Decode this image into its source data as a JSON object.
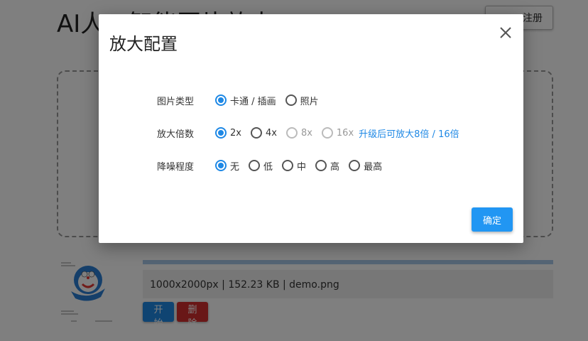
{
  "background": {
    "page_title": "AI人工智能图片放大",
    "auth_button_label": "注册",
    "file_info": "1000x2000px | 152.23 KB | demo.png",
    "start_button_label": "开始",
    "delete_button_label": "删除",
    "upload_progress": 1.0
  },
  "modal": {
    "title": "放大配置",
    "image_type": {
      "label": "图片类型",
      "options": [
        {
          "label": "卡通 / 插画",
          "checked": true
        },
        {
          "label": "照片",
          "checked": false
        }
      ]
    },
    "scale": {
      "label": "放大倍数",
      "options": [
        {
          "label": "2x",
          "checked": true
        },
        {
          "label": "4x",
          "checked": false
        },
        {
          "label": "8x",
          "checked": false,
          "disabled": true
        },
        {
          "label": "16x",
          "checked": false,
          "disabled": true
        }
      ],
      "upgrade_note": "升级后可放大8倍 / 16倍"
    },
    "denoise": {
      "label": "降噪程度",
      "options": [
        {
          "label": "无",
          "checked": true
        },
        {
          "label": "低",
          "checked": false
        },
        {
          "label": "中",
          "checked": false
        },
        {
          "label": "高",
          "checked": false
        },
        {
          "label": "最高",
          "checked": false
        }
      ]
    },
    "confirm_button_label": "确定"
  },
  "colors": {
    "accent": "#2196f3",
    "danger": "#d32f2f",
    "overlay": "rgba(0,0,0,0.5)"
  }
}
